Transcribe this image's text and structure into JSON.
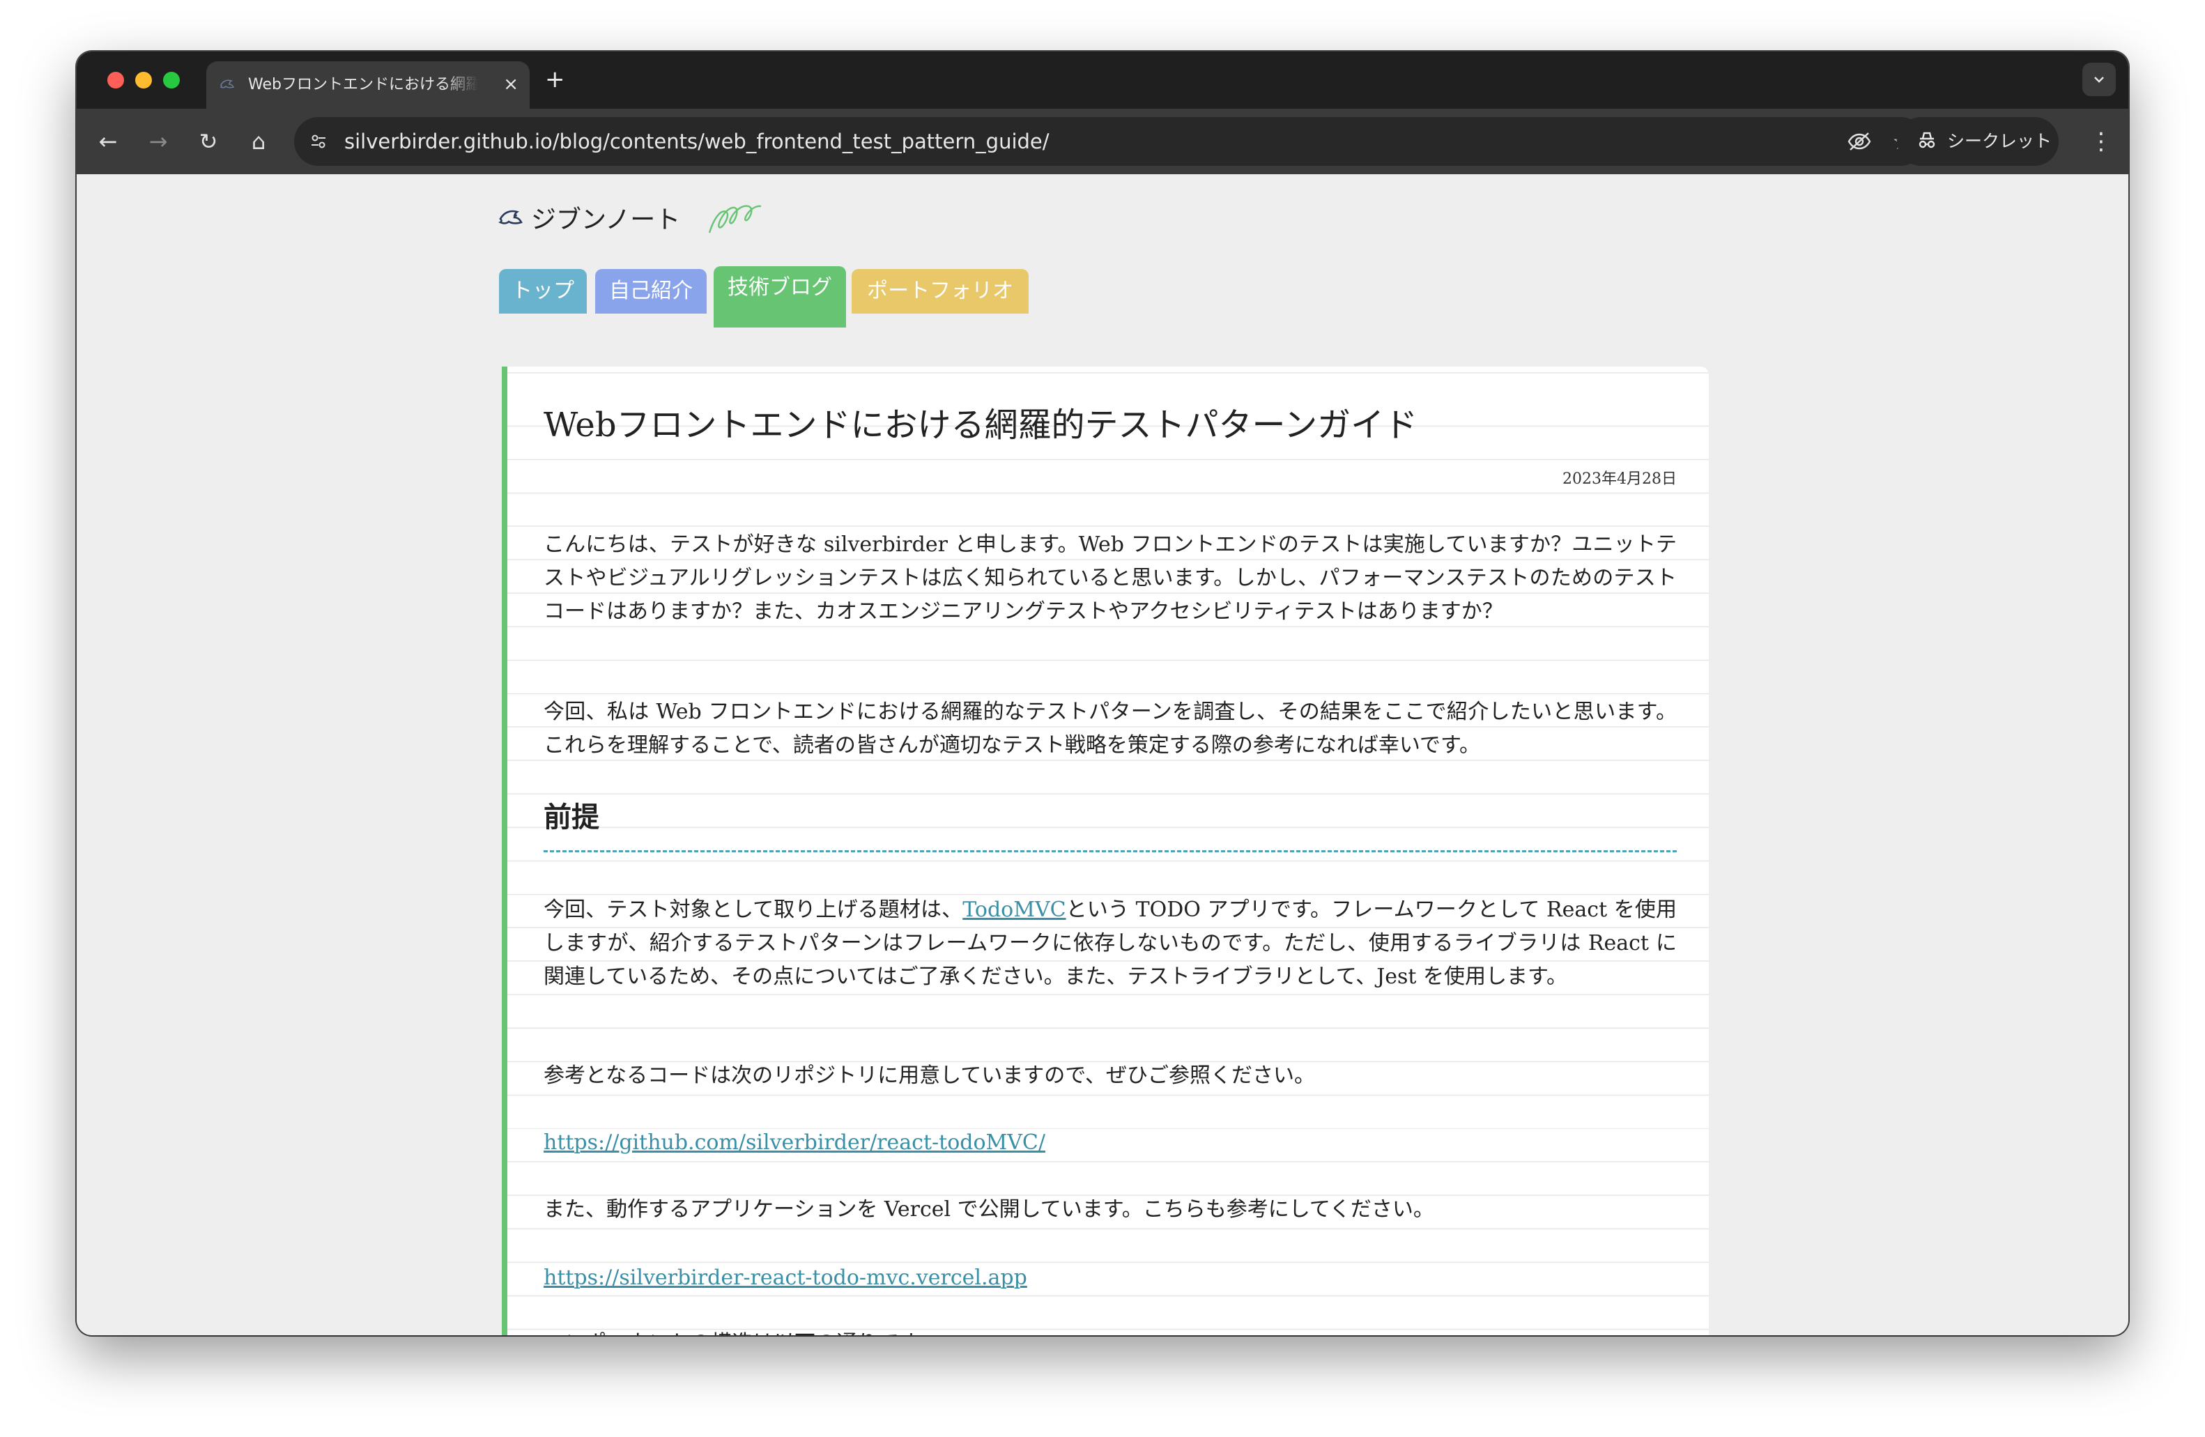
{
  "browser": {
    "tab": {
      "title": "Webフロントエンドにおける網羅的テストパターンガイド",
      "close": "×"
    },
    "new_tab": "+",
    "tab_menu": "⌄",
    "url": "silverbirder.github.io/blog/contents/web_frontend_test_pattern_guide/",
    "incognito_label": "シークレット",
    "nav": {
      "back": "←",
      "forward": "→",
      "reload": "↻",
      "home": "⌂",
      "more": "⋮"
    }
  },
  "site": {
    "logo_text": "ジブンノート",
    "nav_tabs": [
      "トップ",
      "自己紹介",
      "技術ブログ",
      "ポートフォリオ"
    ],
    "active_tab_index": 2
  },
  "article": {
    "title": "Webフロントエンドにおける網羅的テストパターンガイド",
    "date": "2023年4月28日",
    "p1": "こんにちは、テストが好きな silverbirder と申します。Web フロントエンドのテストは実施していますか？ユニットテストやビジュアルリグレッションテストは広く知られていると思います。しかし、パフォーマンステストのためのテストコードはありますか？また、カオスエンジニアリングテストやアクセシビリティテストはありますか？",
    "p2": "今回、私は Web フロントエンドにおける網羅的なテストパターンを調査し、その結果をここで紹介したいと思います。これらを理解することで、読者の皆さんが適切なテスト戦略を策定する際の参考になれば幸いです。",
    "h2": "前提",
    "p3_before": "今回、テスト対象として取り上げる題材は、",
    "p3_link": "TodoMVC",
    "p3_after": "という TODO アプリです。フレームワークとして React を使用しますが、紹介するテストパターンはフレームワークに依存しないものです。ただし、使用するライブラリは React に関連しているため、その点についてはご了承ください。また、テストライブラリとして、Jest を使用します。",
    "p4": "参考となるコードは次のリポジトリに用意していますので、ぜひご参照ください。",
    "link1": "https://github.com/silverbirder/react-todoMVC/",
    "p5": "また、動作するアプリケーションを Vercel で公開しています。こちらも参考にしてください。",
    "link2": "https://silverbirder-react-todo-mvc.vercel.app",
    "p6": "コンポーネントの構造は以下の通りです。"
  },
  "colors": {
    "accent_green": "#66c472",
    "tab_top": "#6ab3cf",
    "tab_about": "#8aa4ec",
    "tab_portfolio": "#e8c868",
    "link": "#3a8fa6"
  }
}
